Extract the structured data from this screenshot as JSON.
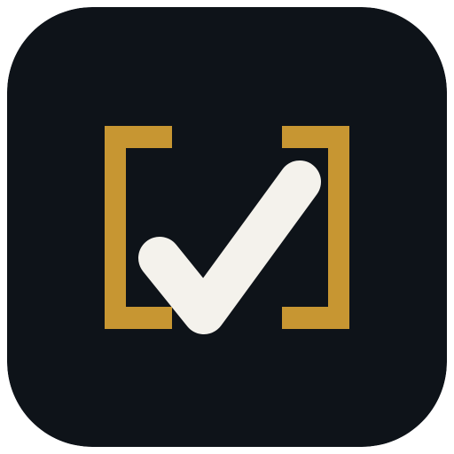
{
  "icon": {
    "name": "checkbox-brackets-app-icon",
    "colors": {
      "background": "#0E1319",
      "bracket": "#C79632",
      "check": "#F4F2EC"
    }
  }
}
